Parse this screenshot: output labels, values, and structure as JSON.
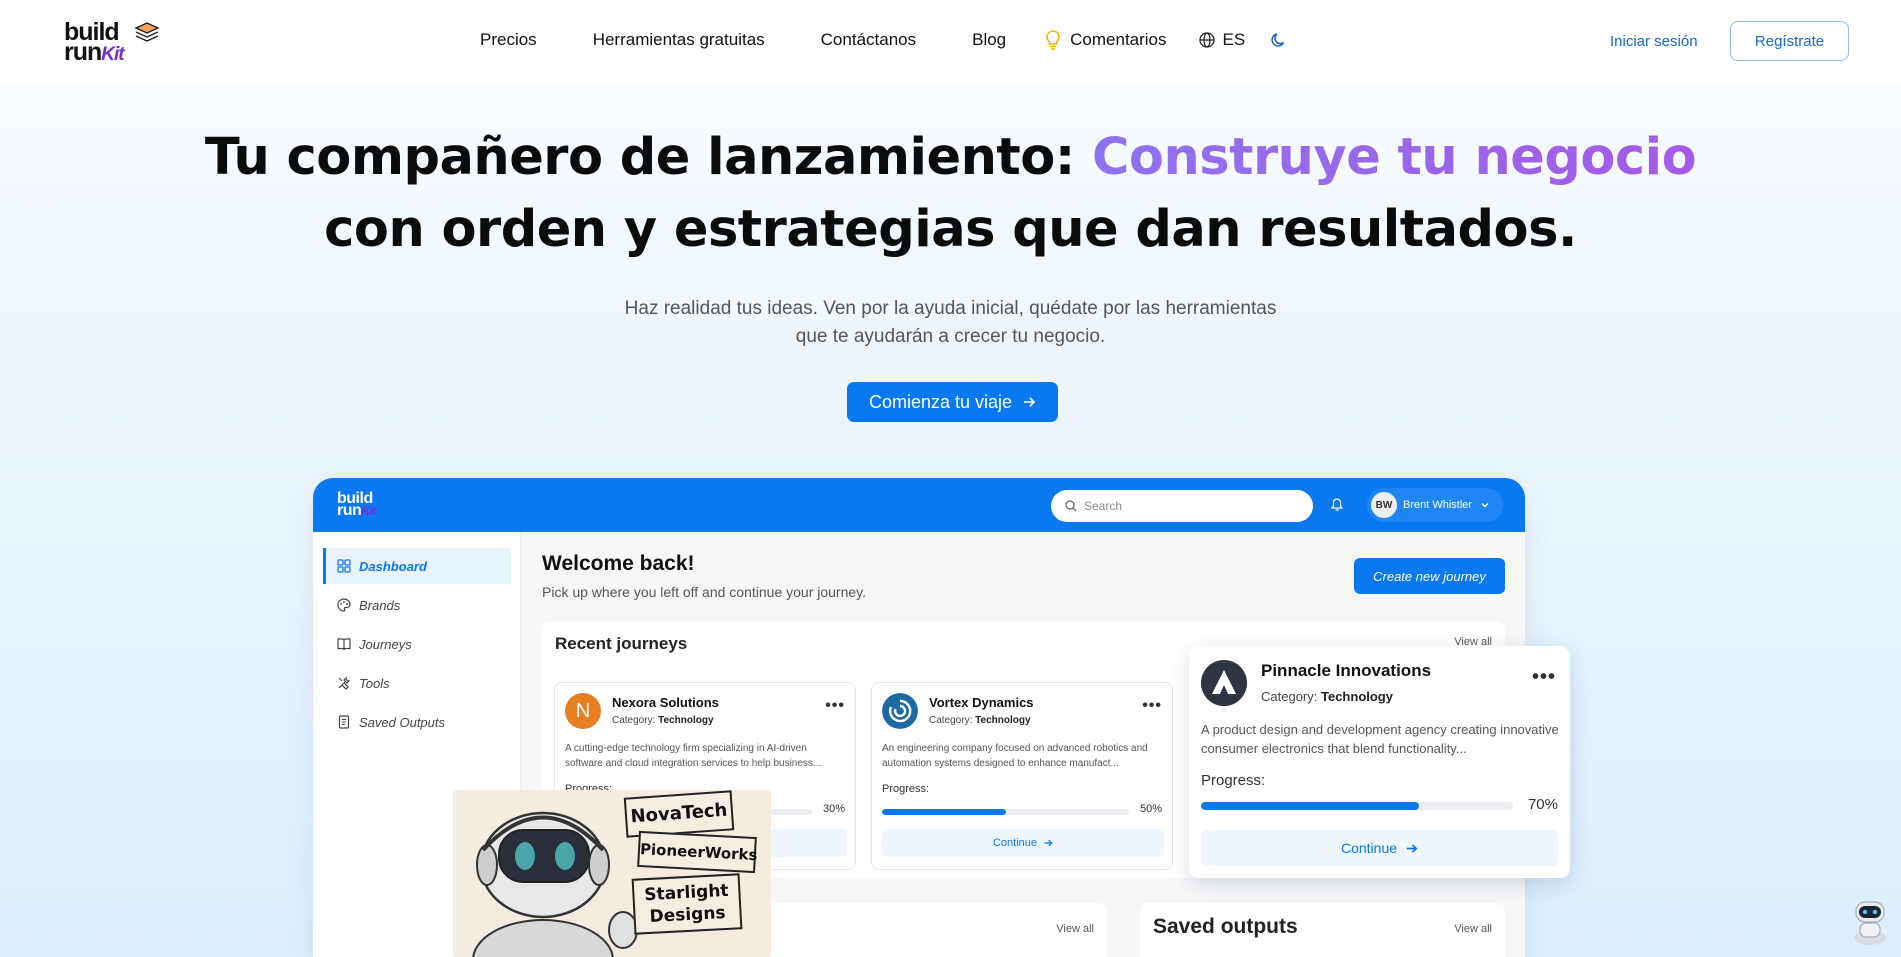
{
  "brand": {
    "line1": "build",
    "line2": "run",
    "kit": "Kit"
  },
  "nav": {
    "links": [
      "Precios",
      "Herramientas gratuitas",
      "Contáctanos",
      "Blog"
    ],
    "feedback": "Comentarios",
    "language": "ES",
    "login": "Iniciar sesión",
    "register": "Regístrate"
  },
  "hero": {
    "title_part1": "Tu compañero de lanzamiento: ",
    "title_highlight": "Construye tu negocio",
    "title_line2": "con orden y estrategias que dan resultados.",
    "subtitle_line1": "Haz realidad tus ideas. Ven por la ayuda inicial, quédate por las herramientas",
    "subtitle_line2": "que te ayudarán a crecer tu negocio.",
    "cta": "Comienza tu viaje"
  },
  "app": {
    "search_placeholder": "Search",
    "user_initials": "BW",
    "user_name": "Brent Whistler",
    "sidebar": [
      {
        "label": "Dashboard",
        "icon": "grid-icon",
        "active": true
      },
      {
        "label": "Brands",
        "icon": "palette-icon"
      },
      {
        "label": "Journeys",
        "icon": "book-icon"
      },
      {
        "label": "Tools",
        "icon": "tools-icon"
      },
      {
        "label": "Saved Outputs",
        "icon": "document-icon"
      }
    ],
    "welcome_title": "Welcome back!",
    "welcome_sub": "Pick up where you left off and continue your journey.",
    "new_journey": "Create new journey",
    "recent_title": "Recent journeys",
    "view_all": "View all",
    "category_label": "Category:",
    "progress_label": "Progress:",
    "continue_label": "Continue",
    "journeys": [
      {
        "initial": "N",
        "name": "Nexora Solutions",
        "category": "Technology",
        "description": "A cutting-edge technology firm specializing in AI-driven software and cloud integration services to help business...",
        "progress": 30,
        "progress_text": "30%",
        "color": "#e67e22"
      },
      {
        "name": "Vortex Dynamics",
        "category": "Technology",
        "description": "An engineering company focused on advanced robotics and automation systems designed to enhance manufact...",
        "progress": 50,
        "progress_text": "50%",
        "color": "#1b6aa5"
      },
      {
        "name": "Pinnacle Innovations",
        "category": "Technology",
        "description": "A product design and development agency creating innovative consumer electronics that blend functionality...",
        "progress": 70,
        "progress_text": "70%",
        "color": "#2e3440"
      }
    ],
    "saved_outputs_title": "Saved outputs"
  },
  "illustration": {
    "signs": [
      "NovaTech",
      "PioneerWorks",
      "Starlight",
      "Designs"
    ]
  },
  "colors": {
    "primary": "#0a78f0",
    "accent_purple": "#a55ae6",
    "text": "#111111"
  }
}
